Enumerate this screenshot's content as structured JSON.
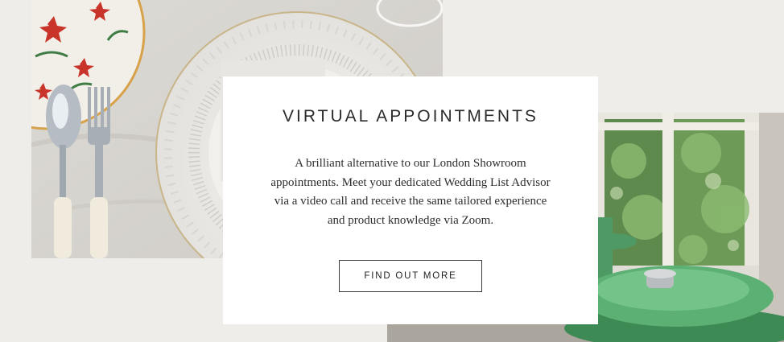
{
  "promo": {
    "title": "VIRTUAL APPOINTMENTS",
    "body": "A brilliant alternative to our London Showroom appointments. Meet your dedicated Wedding List Advisor via a video call and receive the same tailored experience and product knowledge via Zoom.",
    "cta_label": "FIND OUT MORE"
  },
  "images": {
    "left": "table-setting-photo",
    "right": "green-casserole-window-photo"
  },
  "colors": {
    "page_background": "#efedea",
    "card_background": "#ffffff",
    "text": "#2b2b2b",
    "casserole_green": "#57a86e"
  }
}
